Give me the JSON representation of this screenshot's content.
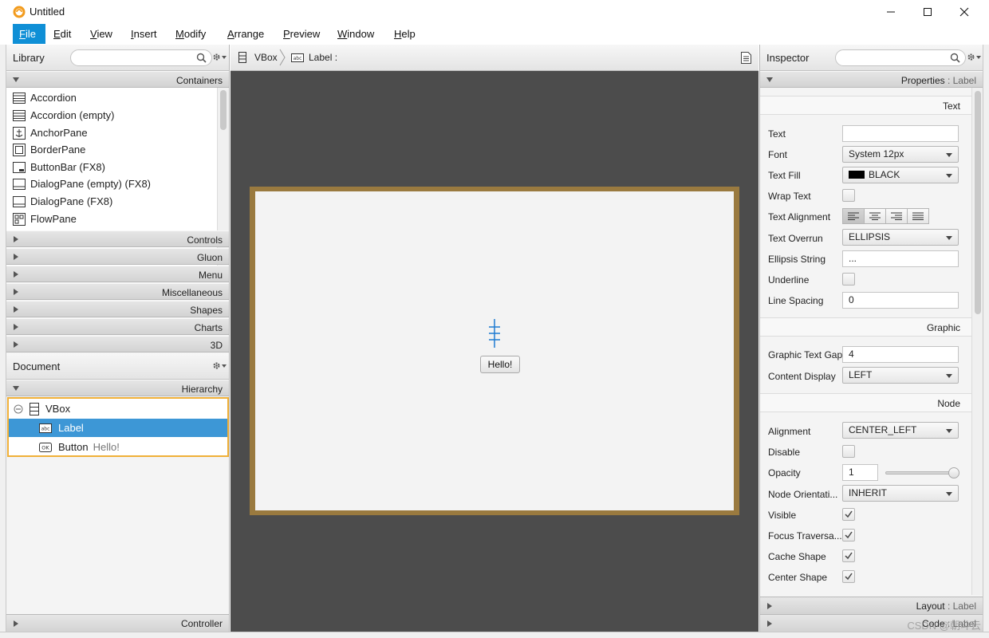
{
  "window": {
    "title": "Untitled"
  },
  "menu": {
    "items": [
      {
        "label": "File",
        "underline": "F",
        "rest": "ile",
        "active": true
      },
      {
        "label": "Edit",
        "underline": "E",
        "rest": "dit"
      },
      {
        "label": "View",
        "underline": "V",
        "rest": "iew"
      },
      {
        "label": "Insert",
        "underline": "I",
        "rest": "nsert"
      },
      {
        "label": "Modify",
        "underline": "M",
        "rest": "odify"
      },
      {
        "label": "Arrange",
        "underline": "A",
        "rest": "rrange"
      },
      {
        "label": "Preview",
        "underline": "P",
        "rest": "review"
      },
      {
        "label": "Window",
        "underline": "W",
        "rest": "indow"
      },
      {
        "label": "Help",
        "underline": "H",
        "rest": "elp"
      }
    ]
  },
  "library": {
    "title": "Library",
    "search_placeholder": "",
    "open_section": "Containers",
    "items": [
      {
        "label": "Accordion",
        "icon": "accordion-icon"
      },
      {
        "label": "Accordion  (empty)",
        "icon": "accordion-icon"
      },
      {
        "label": "AnchorPane",
        "icon": "anchor-icon"
      },
      {
        "label": "BorderPane",
        "icon": "borderpane-icon"
      },
      {
        "label": "ButtonBar  (FX8)",
        "icon": "buttonbar-icon"
      },
      {
        "label": "DialogPane (empty)  (FX8)",
        "icon": "dialogpane-icon"
      },
      {
        "label": "DialogPane  (FX8)",
        "icon": "dialogpane-icon"
      },
      {
        "label": "FlowPane",
        "icon": "flowpane-icon"
      }
    ],
    "collapsed_sections": [
      "Controls",
      "Gluon",
      "Menu",
      "Miscellaneous",
      "Shapes",
      "Charts",
      "3D"
    ]
  },
  "document": {
    "title": "Document",
    "section": "Hierarchy",
    "tree": {
      "root": "VBox",
      "children": [
        {
          "type": "Label",
          "text": "",
          "selected": true
        },
        {
          "type": "Button",
          "text": "Hello!",
          "selected": false
        }
      ]
    },
    "footer": "Controller"
  },
  "center": {
    "breadcrumb": [
      "VBox",
      "Label :"
    ],
    "canvas_button_label": "Hello!"
  },
  "inspector": {
    "title": "Inspector",
    "search_placeholder": "",
    "header_section": "Properties",
    "header_target": ": Label",
    "sections": {
      "text": "Text",
      "graphic": "Graphic",
      "node": "Node"
    },
    "props": {
      "text": {
        "label": "Text",
        "value": ""
      },
      "font": {
        "label": "Font",
        "value": "System 12px"
      },
      "text_fill": {
        "label": "Text Fill",
        "value": "BLACK",
        "color": "#000000"
      },
      "wrap_text": {
        "label": "Wrap Text"
      },
      "text_alignment": {
        "label": "Text Alignment",
        "selected": "left"
      },
      "text_overrun": {
        "label": "Text Overrun",
        "value": "ELLIPSIS"
      },
      "ellipsis_string": {
        "label": "Ellipsis String",
        "value": "..."
      },
      "underline": {
        "label": "Underline"
      },
      "line_spacing": {
        "label": "Line Spacing",
        "value": "0"
      },
      "graphic_text_gap": {
        "label": "Graphic Text Gap",
        "value": "4"
      },
      "content_display": {
        "label": "Content Display",
        "value": "LEFT"
      },
      "alignment": {
        "label": "Alignment",
        "value": "CENTER_LEFT"
      },
      "disable": {
        "label": "Disable"
      },
      "opacity": {
        "label": "Opacity",
        "value": "1",
        "level": 1.0
      },
      "node_orientation": {
        "label": "Node Orientati...",
        "value": "INHERIT"
      },
      "visible": {
        "label": "Visible",
        "checked": true
      },
      "focus_traversable": {
        "label": "Focus Traversa...",
        "checked": true
      },
      "cache_shape": {
        "label": "Cache Shape",
        "checked": true
      },
      "center_shape": {
        "label": "Center Shape",
        "checked": true
      }
    },
    "footers": [
      {
        "name": "Layout",
        "target": ": Label"
      },
      {
        "name": "Code",
        "target": ": Label"
      }
    ]
  },
  "watermark": "CSDN @朝斗云"
}
